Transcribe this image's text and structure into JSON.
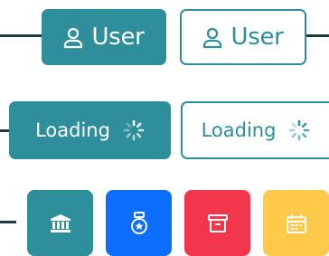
{
  "row1": {
    "filled_label": "User",
    "outline_label": "User",
    "icon": "user-icon"
  },
  "row2": {
    "filled_label": "Loading",
    "outline_label": "Loading",
    "icon": "spinner-icon"
  },
  "row3": {
    "buttons": [
      {
        "icon": "bank-icon",
        "color": "#2e8f9b"
      },
      {
        "icon": "medal-icon",
        "color": "#0d6efd"
      },
      {
        "icon": "archive-icon",
        "color": "#f2374d"
      },
      {
        "icon": "calendar-icon",
        "color": "#ffc94a"
      }
    ]
  },
  "colors": {
    "accent": "#2e8f9b",
    "connector": "#1f3a44",
    "primary": "#0d6efd",
    "danger": "#f2374d",
    "warning": "#ffc94a"
  }
}
